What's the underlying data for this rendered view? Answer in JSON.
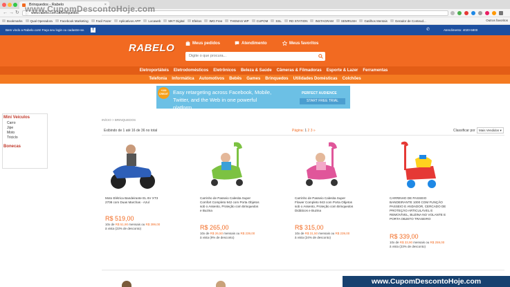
{
  "browser": {
    "tab_title": "Brinquedos - Rabelo",
    "url": "www.rabelo.com.br/brinquedos",
    "bookmarks": [
      "Bookmarks",
      "Qual Operadora",
      "Facebook Marketing",
      "Facil Fazer",
      "Aplicativos APP",
      "Locaweb",
      "MKT Digital",
      "Efeitos",
      "IMG Free",
      "THEMAS WP",
      "CUPOM",
      "SSL",
      "RD STATION",
      "INSTAGRAM",
      "SEMRUSH",
      "Gatilhos Mentais",
      "Gerador de Conteud..."
    ],
    "other_bookmarks": "Outros favoritos"
  },
  "watermark": "www.CupomDescontoHoje.com",
  "top_strip": {
    "welcome": "Bem vindo a Rabelo.com! Faça seu login ou cadastre-se.",
    "service": "Atendimento: 4020-5800"
  },
  "header": {
    "logo": "RABELO",
    "links": [
      "Meus pedidos",
      "Atendimento",
      "Meus favoritos"
    ],
    "search_placeholder": "Digite o que procura..."
  },
  "categories_1": [
    "Eletroportáteis",
    "Eletrodomésticos",
    "Eletrônicos",
    "Beleza & Saúde",
    "Câmeras & Filmadoras",
    "Esporte & Lazer",
    "Ferramentas"
  ],
  "categories_2": [
    "Telefonia",
    "Informática",
    "Automotivos",
    "Bebês",
    "Games",
    "Brinquedos",
    "Utilidades Domésticas",
    "Colchões"
  ],
  "banner": {
    "badge": "+100 CREDIT",
    "text": "Easy retargeting across Facebook, Mobile, Twitter, and the Web in one powerful platform.",
    "brand": "PERFECT AUDIENCE",
    "cta": "START FREE TRIAL"
  },
  "sidebar": {
    "heading_1": "Mini Veículos",
    "items": [
      "Carro",
      "Jipe",
      "Moto",
      "Triciclo"
    ],
    "heading_2": "Bonecas"
  },
  "breadcrumb": "INÍCIO > BRINQUEDOS",
  "listing": {
    "info": "Exibindo de 1 até 16 de 36 no total",
    "pages_label": "Página:",
    "pages": [
      "1",
      "2",
      "3",
      "»"
    ],
    "sort_label": "Classificar por",
    "sort_value": "Mais Vendidos ▾"
  },
  "products": [
    {
      "name": "Moto Elétrica Bandeirante EL 6V XT3 2708 com Duas Marchas - Azul",
      "price": "R$ 519,00",
      "inst_a": "10x de ",
      "inst_b": "R$ 51,90",
      "inst_c": " mensais ou ",
      "inst_d": "R$ 399,00",
      "inst_e": " à vista (23% de desconto)"
    },
    {
      "name": "Carrinho de Passeio Calesita Super Comfort Completo 942 com Porta Objetos sob o Assento, Proteção com Brinquedos e Buzina",
      "price": "R$ 265,00",
      "inst_a": "10x de ",
      "inst_b": "R$ 26,50",
      "inst_c": " mensais ou ",
      "inst_d": "R$ 239,00",
      "inst_e": " à vista (9% de desconto)"
    },
    {
      "name": "Carrinho de Passeio Calesita Super Flower Completo 943 com Porta Objetos sob o Assento, Proteção com Brinquedos Didáticos e Buzina",
      "price": "R$ 315,00",
      "inst_a": "10x de ",
      "inst_b": "R$ 31,50",
      "inst_c": " mensais ou ",
      "inst_d": "R$ 239,00",
      "inst_e": " à vista (24% de desconto)"
    },
    {
      "name": "CARRINHO DE PASSEIO BANDEIRANTE 1000 COM FUNÇÃO PASSEIO E ANDADOR, CERCADO DE PROTEÇÃO ARTICULÁVEL E REMOVÍVEL, BUZINA NO VOLANTE E PORTA OBJETO TRASEIRO",
      "price": "R$ 339,00",
      "inst_a": "10x de ",
      "inst_b": "R$ 33,90",
      "inst_c": " mensais ou ",
      "inst_d": "R$ 259,00",
      "inst_e": " à vista (23% de desconto)"
    }
  ],
  "footer_banner": "www.CupomDescontoHoje.com"
}
